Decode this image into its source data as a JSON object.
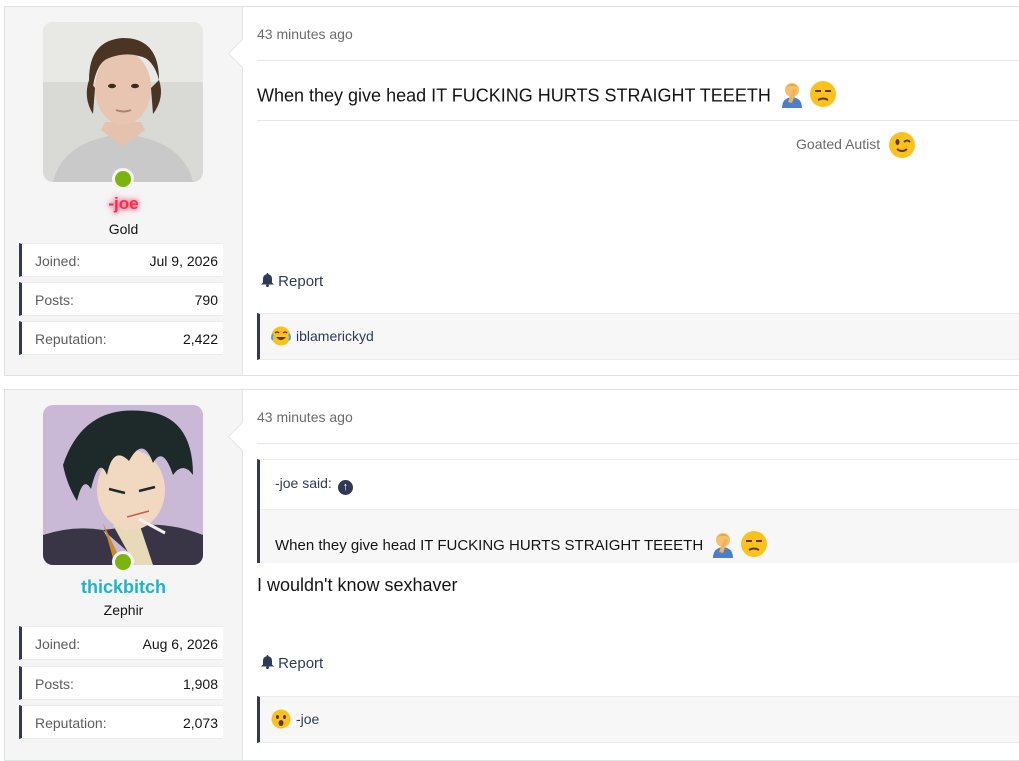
{
  "posts": [
    {
      "user": {
        "name": "-joe",
        "title": "Gold",
        "stats": [
          {
            "label": "Joined:",
            "value": "Jul 9, 2026"
          },
          {
            "label": "Posts:",
            "value": "790"
          },
          {
            "label": "Reputation:",
            "value": "2,422"
          }
        ]
      },
      "time": "43 minutes ago",
      "body": "When they give head IT FUCKING HURTS STRAIGHT TEEETH",
      "signature": "Goated Autist",
      "report": "Report",
      "reaction_user": "iblamerickyd"
    },
    {
      "user": {
        "name": "thickbitch",
        "title": "Zephir",
        "stats": [
          {
            "label": "Joined:",
            "value": "Aug 6, 2026"
          },
          {
            "label": "Posts:",
            "value": "1,908"
          },
          {
            "label": "Reputation:",
            "value": "2,073"
          }
        ]
      },
      "time": "43 minutes ago",
      "quote": {
        "author": "-joe said:",
        "text": "When they give head IT FUCKING HURTS STRAIGHT TEEETH"
      },
      "body": "I wouldn't know sexhaver",
      "report": "Report",
      "reaction_user": "-joe"
    }
  ],
  "colors": {
    "accent": "#2f3b56",
    "online": "#7bb40f",
    "username1": "#ff2a4a",
    "username2": "#1fb4c9"
  },
  "icons": [
    "facepalm-emoji",
    "unamused-emoji",
    "wink-emoji",
    "bell-icon",
    "laugh-cry-emoji",
    "arrow-up-icon",
    "wow-emoji"
  ]
}
